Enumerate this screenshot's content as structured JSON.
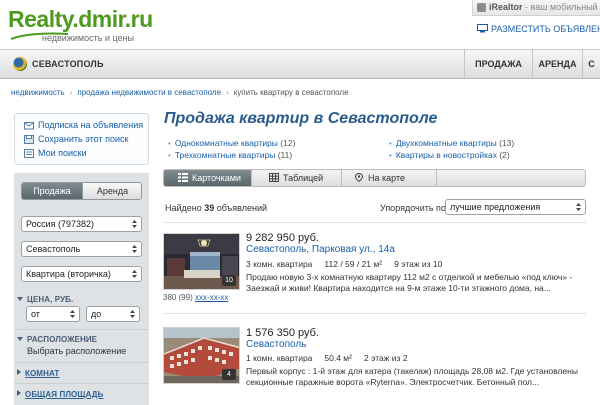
{
  "header": {
    "logo": "Realty.dmir.ru",
    "tagline": "недвижимость и цены",
    "irealtor_name": "iRealtor",
    "irealtor_sub": " - ваш мобильный риэлтор",
    "publish_link": "РАЗМЕСТИТЬ ОБЪЯВЛЕНИЕ"
  },
  "nav": {
    "city": "СЕВАСТОПОЛЬ",
    "items": [
      "ПРОДАЖА",
      "АРЕНДА",
      "С"
    ]
  },
  "breadcrumb": {
    "items": [
      "недвижимость",
      "продажа недвижимости в севастополе"
    ],
    "current": "купить квартиру в севастополе"
  },
  "sidebar": {
    "links": [
      "Подписка на объявления",
      "Сохранить этот поиск",
      "Мои поиски"
    ],
    "deal_tabs": [
      "Продажа",
      "Аренда"
    ],
    "country_select": "Россия (797382)",
    "city_select": "Севастополь",
    "type_select": "Квартира (вторичка)",
    "price_section": "ЦЕНА, РУБ.",
    "price_from": "от",
    "price_to": "до",
    "location_section": "РАСПОЛОЖЕНИЕ",
    "location_choose": "Выбрать расположение",
    "rooms_section": "КОМНАТ",
    "area_section": "ОБЩАЯ ПЛОЩАДЬ"
  },
  "main": {
    "title": "Продажа квартир в Севастополе",
    "categories": [
      {
        "label": "Однокомнатные квартиры",
        "count": "(12)"
      },
      {
        "label": "Двухкомнатные квартиры",
        "count": "(13)"
      },
      {
        "label": "Трехкомнатные квартиры",
        "count": "(11)"
      },
      {
        "label": "Квартиры в новостройках",
        "count": "(2)"
      }
    ],
    "tabs": [
      "Карточками",
      "Таблицей",
      "На карте"
    ],
    "found_prefix": "Найдено ",
    "found_count": "39",
    "found_suffix": " объявлений",
    "sort_label": "Упорядочить по",
    "sort_value": "лучшие предложения"
  },
  "listings": [
    {
      "price": "9 282 950",
      "currency": "руб.",
      "address": "Севастополь, Парковая ул., 14а",
      "rooms": "3 комн. квартира",
      "area": "112 / 59 / 21 м²",
      "floor": "9 этаж из 10",
      "description": "Продаю новую 3-х комнатную квартиру 112 м2 с отделкой и мебелью «под ключ» - Заезжай и живи! Квартира находится на 9-м этаже 10-ти этажного дома, на...",
      "photo_count": "10",
      "phone_prefix": "380 (99) ",
      "phone_link": "xxx-xx-xx"
    },
    {
      "price": "1 576 350",
      "currency": "руб.",
      "address": "Севастополь",
      "rooms": "1 комн. квартира",
      "area": "50.4 м²",
      "floor": "2 этаж из 2",
      "description": "Первый корпус : 1-й этаж для катера (такелаж) площадь 28,08 м2. Где установлены секционные гаражные ворота «Ryterna». Электросчетчик. Бетонный пол...",
      "photo_count": "4"
    }
  ],
  "colors": {
    "brand_green": "#4d9a1e",
    "link_blue": "#1a5fa8",
    "title_blue": "#2a5b8c",
    "active_tab": "#6b767c"
  }
}
